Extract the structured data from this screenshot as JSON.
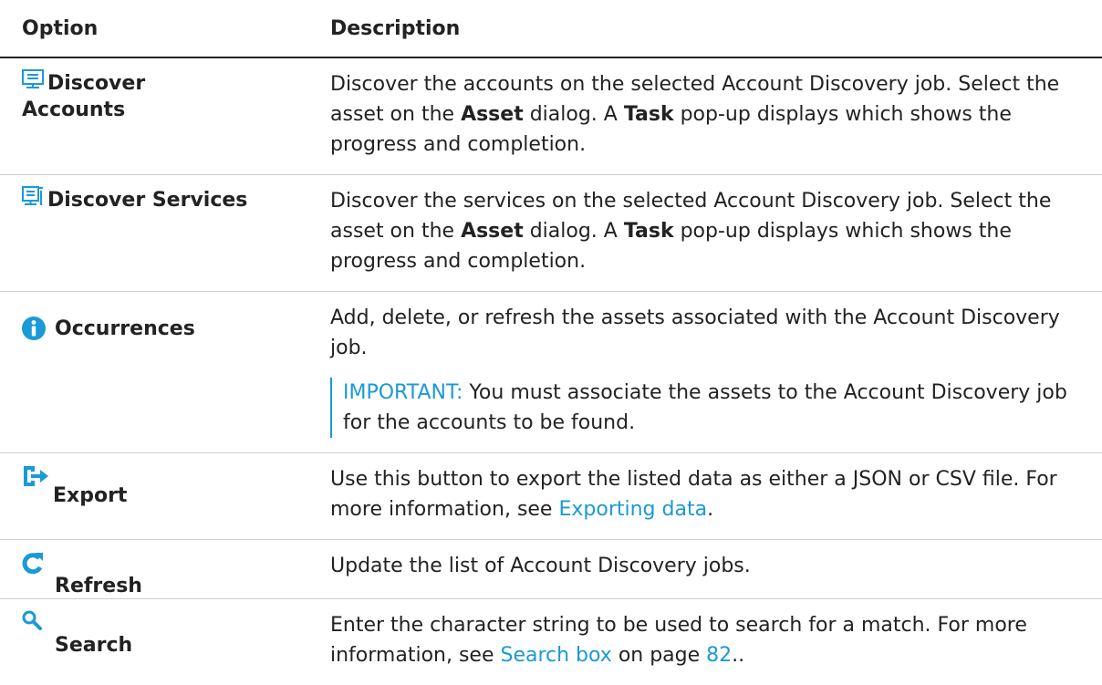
{
  "header": {
    "option": "Option",
    "description": "Description"
  },
  "colors": {
    "accent": "#1a9ad6",
    "text": "#222222",
    "rule": "#cfcfcf"
  },
  "rows": [
    {
      "icon": "discover-accounts-icon",
      "label_line1": "Discover",
      "label_line2": "Accounts",
      "desc": {
        "a": "Discover the accounts on the selected Account Discovery job. Select the asset on the ",
        "b1": "Asset",
        "c": " dialog. A ",
        "b2": "Task",
        "d": " pop-up displays which shows the progress and completion."
      }
    },
    {
      "icon": "discover-services-icon",
      "label_line1": "Discover Services",
      "desc": {
        "a": "Discover the services on the selected Account Discovery job. Select the asset on the ",
        "b1": "Asset",
        "c": " dialog. A ",
        "b2": "Task",
        "d": " pop-up displays which shows the progress and completion."
      }
    },
    {
      "icon": "info-icon",
      "label_line1": "Occurrences",
      "desc": {
        "a": "Add, delete, or refresh the assets associated with the Account Discovery job."
      },
      "note": {
        "label": "IMPORTANT:",
        "text": " You must associate the assets to the Account Discovery job for the accounts to be found."
      }
    },
    {
      "icon": "export-icon",
      "label_line1": "Export",
      "desc": {
        "a": "Use this button to export the listed data as either a JSON or CSV file. For more information, see ",
        "link": "Exporting data",
        "b": "."
      }
    },
    {
      "icon": "refresh-icon",
      "label_line1": "Refresh",
      "desc": {
        "a": "Update the list of Account Discovery jobs."
      }
    },
    {
      "icon": "search-icon",
      "label_line1": "Search",
      "desc": {
        "a": "Enter the character string to be used to search for a match. For more information, see ",
        "link": "Search box",
        "b": " on page ",
        "page": "82",
        "c": ".."
      }
    }
  ]
}
